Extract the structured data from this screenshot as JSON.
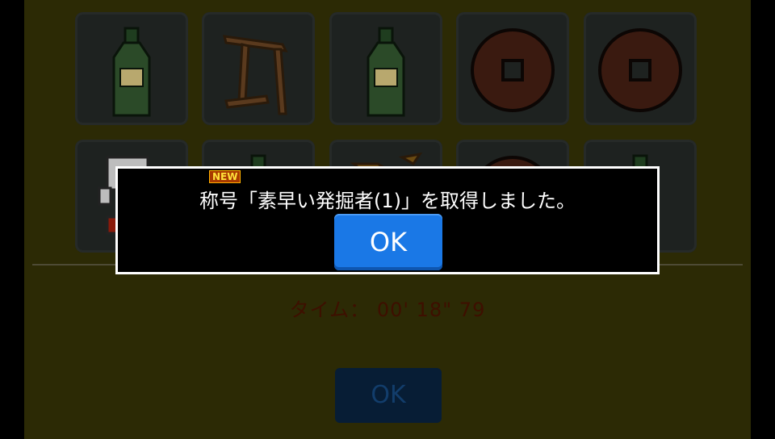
{
  "game": {
    "timer_label": "タイム：",
    "timer_value": "00' 18\" 79",
    "bottom_ok_label": "OK"
  },
  "tiles_row1": [
    "bottle",
    "torii-stick",
    "bottle",
    "coin",
    "coin"
  ],
  "tiles_row2": [
    "robot",
    "bottle",
    "stick",
    "coin",
    "bottle"
  ],
  "dialog": {
    "badge": "NEW",
    "message": "称号「素早い発掘者(1)」を取得しました。",
    "ok_label": "OK"
  },
  "colors": {
    "board": "#2c2a05",
    "accent_button": "#1a78e6",
    "timer_text": "#3e0f00"
  }
}
